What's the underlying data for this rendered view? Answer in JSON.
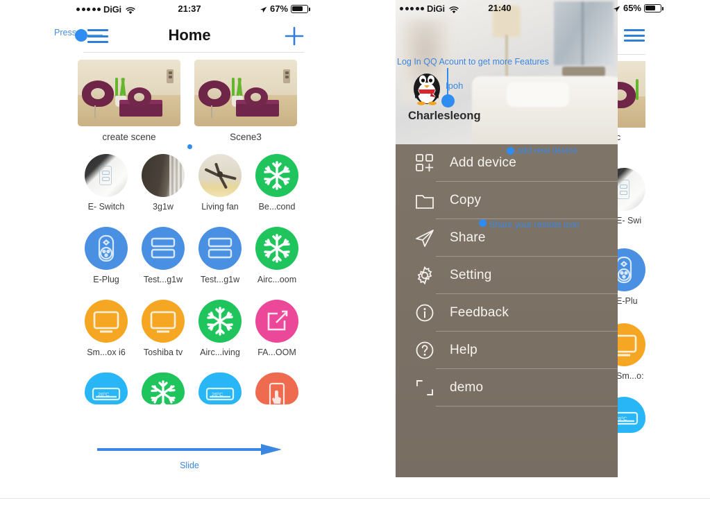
{
  "left_phone": {
    "statusbar": {
      "carrier": "DiGi",
      "signal_dots": 5,
      "wifi_icon": "wifi-icon",
      "time": "21:37",
      "location_icon": "location-arrow-icon",
      "battery_text": "67%",
      "battery_icon": "battery-icon"
    },
    "navbar": {
      "menu_icon": "hamburger-menu-icon",
      "title": "Home",
      "add_icon": "plus-icon"
    },
    "annotations": {
      "press": "Press",
      "slide": "Slide"
    },
    "scenes": [
      {
        "label": "create scene"
      },
      {
        "label": "Scene3"
      }
    ],
    "page_indicator": {
      "dots": 1,
      "active": 0
    },
    "devices": [
      [
        {
          "label": "E- Switch",
          "icon": "photo-wall-switch-icon",
          "style": "photo-switch",
          "color": "#f2f2f0"
        },
        {
          "label": "3g1w",
          "icon": "photo-switch-dark-icon",
          "style": "photo-3g1w",
          "color": "#4a423a"
        },
        {
          "label": "Living fan",
          "icon": "photo-ceiling-fan-icon",
          "style": "photo-fan",
          "color": "#e8e3d8"
        },
        {
          "label": "Be...cond",
          "icon": "snowflake-icon",
          "style": "glyph",
          "color": "#20c45c"
        }
      ],
      [
        {
          "label": "E-Plug",
          "icon": "smart-plug-icon",
          "style": "glyph",
          "color": "#4a90e2"
        },
        {
          "label": "Test...g1w",
          "icon": "two-gang-switch-icon",
          "style": "glyph",
          "color": "#4a90e2"
        },
        {
          "label": "Test...g1w",
          "icon": "two-gang-switch-icon",
          "style": "glyph",
          "color": "#4a90e2"
        },
        {
          "label": "Airc...oom",
          "icon": "snowflake-icon",
          "style": "glyph",
          "color": "#20c45c"
        }
      ],
      [
        {
          "label": "Sm...ox i6",
          "icon": "tv-icon",
          "style": "glyph",
          "color": "#f5a623"
        },
        {
          "label": "Toshiba tv",
          "icon": "tv-icon",
          "style": "glyph",
          "color": "#f5a623"
        },
        {
          "label": "Airc...iving",
          "icon": "snowflake-icon",
          "style": "glyph",
          "color": "#20c45c"
        },
        {
          "label": "FA...OOM",
          "icon": "edit-square-icon",
          "style": "glyph",
          "color": "#ec4899"
        }
      ],
      [
        {
          "label": "",
          "icon": "air-conditioner-icon",
          "style": "glyph",
          "color": "#29b6f6",
          "badge": "26ºC"
        },
        {
          "label": "",
          "icon": "snowflake-icon",
          "style": "glyph",
          "color": "#20c45c"
        },
        {
          "label": "",
          "icon": "air-conditioner-icon",
          "style": "glyph",
          "color": "#29b6f6",
          "badge": "26ºC"
        },
        {
          "label": "",
          "icon": "phone-touch-icon",
          "style": "glyph",
          "color": "#ef6b4f"
        }
      ]
    ]
  },
  "right_phone": {
    "statusbar": {
      "carrier": "DiGi",
      "signal_dots": 5,
      "wifi_icon": "wifi-icon",
      "time": "21:40",
      "location_icon": "location-arrow-icon",
      "battery_text": "65%",
      "battery_icon": "battery-icon"
    },
    "menu_icon": "hamburger-menu-icon",
    "account": {
      "login_prompt": "Log In QQ Acount to get more Features",
      "avatar_icon": "qq-penguin-avatar-icon",
      "location_tag": "Ipoh",
      "username": "Charlesleong"
    },
    "annotations": {
      "add_new_device": "add new device",
      "share_remote": "Share your remote icon"
    },
    "menu": [
      {
        "label": "Add device",
        "icon": "grid-plus-icon"
      },
      {
        "label": "Copy",
        "icon": "folder-icon"
      },
      {
        "label": "Share",
        "icon": "paper-plane-icon"
      },
      {
        "label": "Setting",
        "icon": "gear-icon"
      },
      {
        "label": "Feedback",
        "icon": "info-circle-icon"
      },
      {
        "label": "Help",
        "icon": "question-circle-icon"
      },
      {
        "label": "demo",
        "icon": "crop-frame-icon"
      }
    ],
    "peek_column": [
      {
        "label": "c",
        "icon": "scene-photo-icon",
        "style": "photo",
        "color": "#e2d7bd"
      },
      {
        "label": "E- Swi",
        "icon": "photo-wall-switch-icon",
        "style": "photo-switch",
        "color": "#f2f2f0"
      },
      {
        "label": "E-Plu",
        "icon": "smart-plug-icon",
        "style": "glyph",
        "color": "#4a90e2"
      },
      {
        "label": "Sm...o:",
        "icon": "tv-icon",
        "style": "glyph",
        "color": "#f5a623"
      },
      {
        "label": "",
        "icon": "air-conditioner-icon",
        "style": "glyph",
        "color": "#29b6f6",
        "badge": "26ºC"
      }
    ]
  },
  "theme": {
    "accent_blue": "#2f7fd8",
    "annotation_blue": "#3b86e0",
    "menu_bg": "#7a6f65",
    "green": "#20c45c",
    "blue": "#4a90e2",
    "orange": "#f5a623",
    "pink": "#ec4899",
    "cyan": "#29b6f6",
    "coral": "#ef6b4f",
    "page_bg": "#ffffff"
  }
}
